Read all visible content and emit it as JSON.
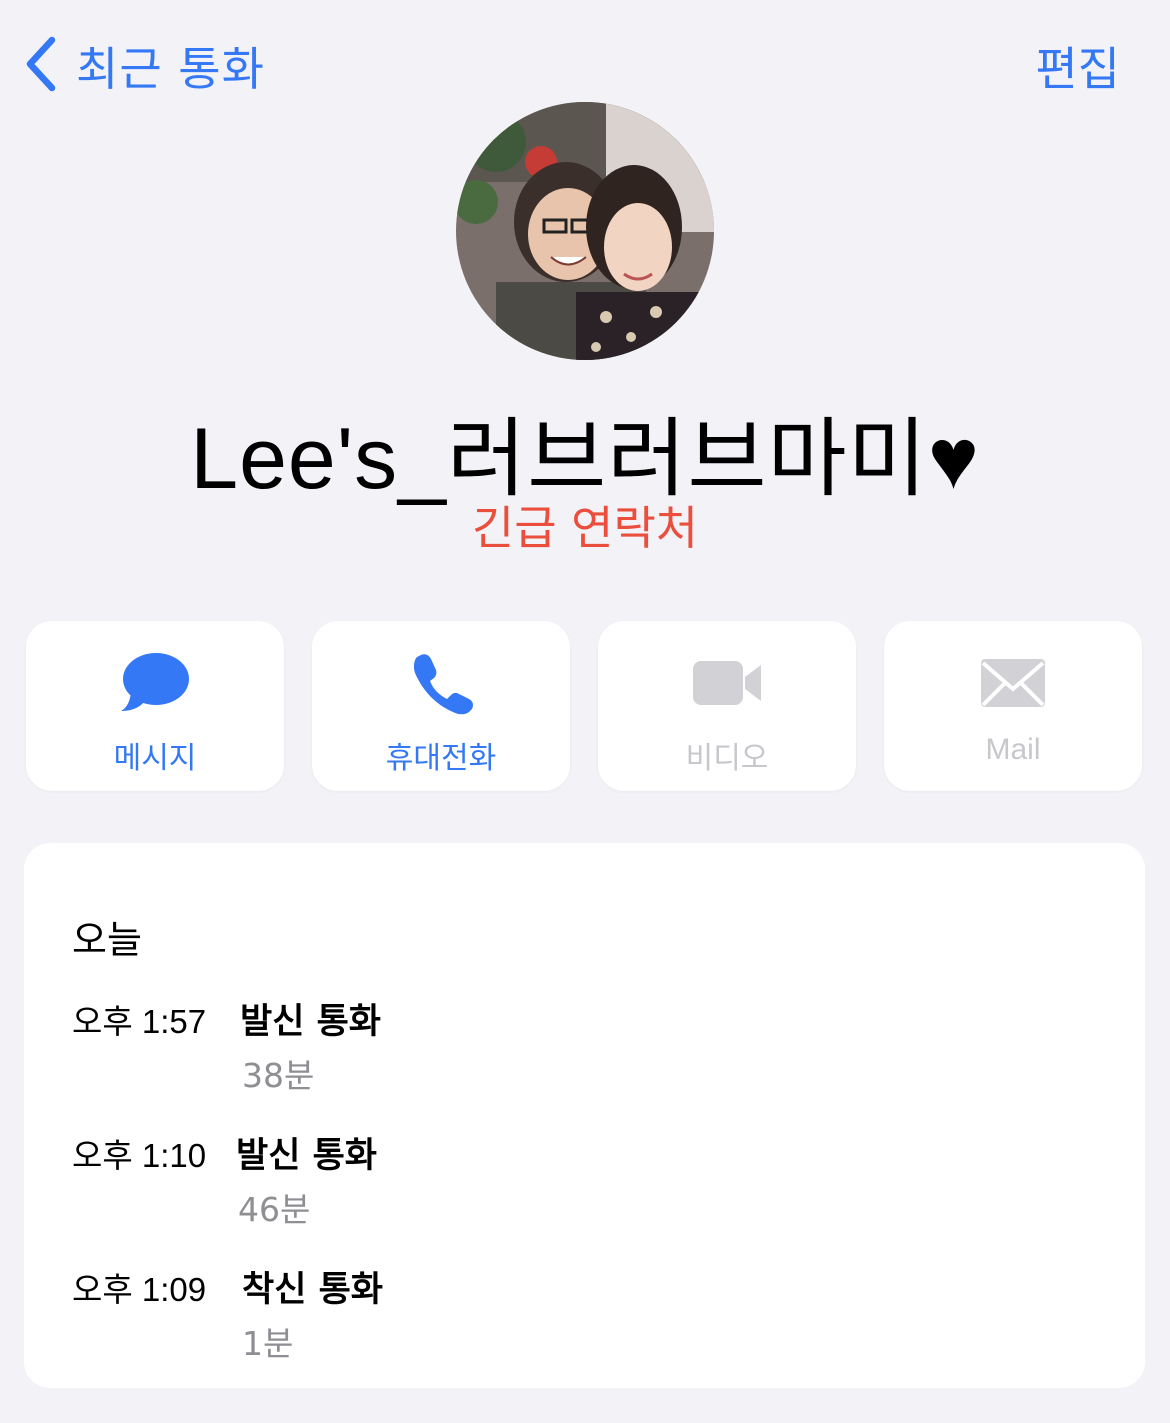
{
  "nav": {
    "back_label": "최근 통화",
    "edit_label": "편집"
  },
  "contact": {
    "name": "Lee's_러브러브마미♥",
    "subtitle": "긴급 연락처"
  },
  "actions": [
    {
      "label": "메시지",
      "icon": "message-bubble-icon",
      "enabled": true
    },
    {
      "label": "휴대전화",
      "icon": "phone-icon",
      "enabled": true
    },
    {
      "label": "비디오",
      "icon": "video-camera-icon",
      "enabled": false
    },
    {
      "label": "Mail",
      "icon": "envelope-icon",
      "enabled": false
    }
  ],
  "recents": {
    "heading": "오늘",
    "calls": [
      {
        "time": "오후 1:57",
        "type": "발신 통화",
        "duration": "38분"
      },
      {
        "time": "오후 1:10",
        "type": "발신 통화",
        "duration": "46분"
      },
      {
        "time": "오후 1:09",
        "type": "착신 통화",
        "duration": "1분"
      }
    ]
  },
  "colors": {
    "accent": "#3478f6",
    "emergency": "#eb4e3d",
    "disabled": "#c7c7cc",
    "background": "#f2f2f7"
  }
}
